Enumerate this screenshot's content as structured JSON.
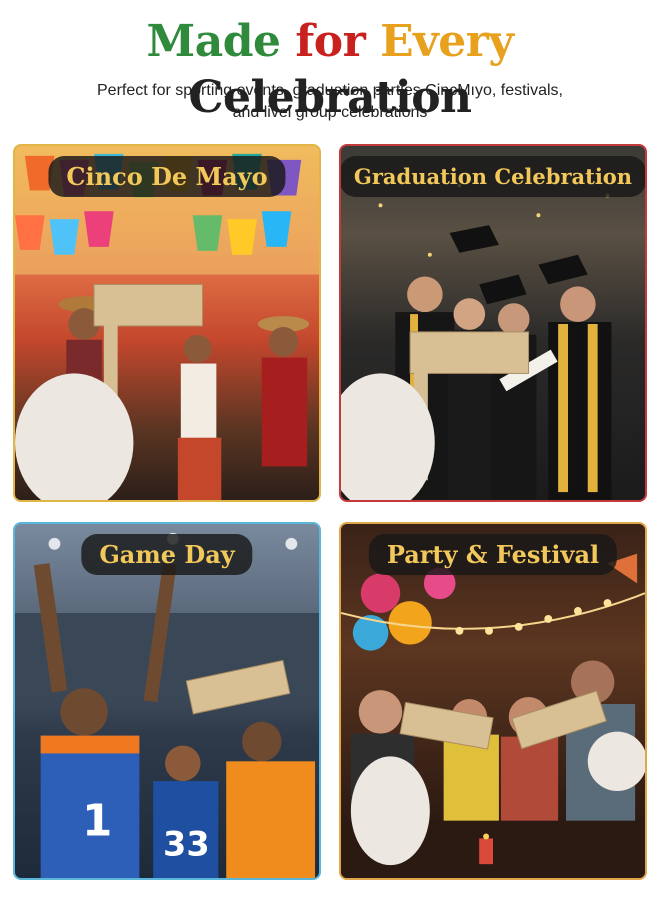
{
  "headline": {
    "word1": "Made",
    "word2": "for",
    "word3": "Every",
    "word4": "Celebration",
    "colors": [
      "#2f8a3c",
      "#c8221f",
      "#e7a11c",
      "#2f8a3c",
      "#222222"
    ]
  },
  "subtitle": {
    "line1": "Perfect for sporting events, graduation parties CincMıyo, festivals,",
    "line2": "and livel group celebrations"
  },
  "panels": [
    {
      "label": "Cinco De Mayo"
    },
    {
      "label": "Graduation Celebration"
    },
    {
      "label": "Game Day"
    },
    {
      "label": "Party & Festival"
    }
  ],
  "jerseys": {
    "left": "1",
    "right": "33"
  }
}
